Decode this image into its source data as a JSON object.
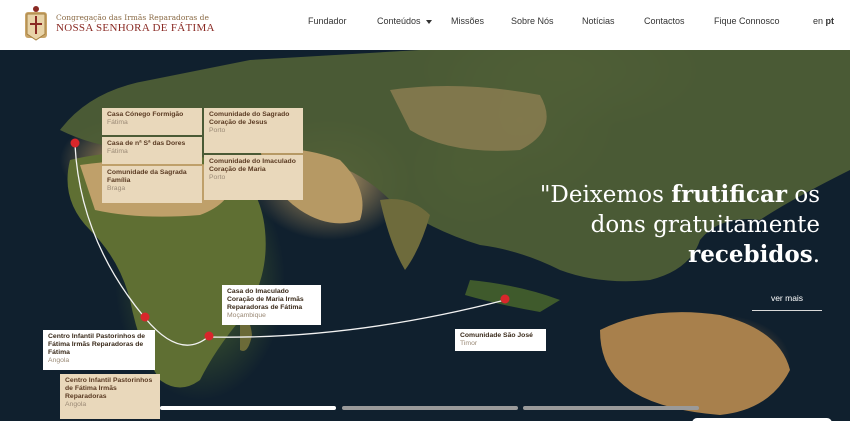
{
  "header": {
    "brand_small": "Congregação das Irmãs Reparadoras de",
    "brand_big": "NOSSA SENHORA DE FÁTIMA",
    "nav": [
      {
        "label": "Fundador"
      },
      {
        "label": "Conteúdos"
      },
      {
        "label": "Missões"
      },
      {
        "label": "Sobre Nós"
      },
      {
        "label": "Notícias"
      },
      {
        "label": "Contactos"
      },
      {
        "label": "Fique Connosco"
      }
    ],
    "lang_en": "en",
    "lang_pt": "pt"
  },
  "hero": {
    "locations": [
      {
        "title": "Casa Cónego Formigão",
        "place": "Fátima"
      },
      {
        "title": "Casa de nª Sª das Dores",
        "place": "Fátima"
      },
      {
        "title": "Comunidade da Sagrada Família",
        "place": "Braga"
      },
      {
        "title": "Comunidade do Sagrado Coração de Jesus",
        "place": "Porto"
      },
      {
        "title": "Comunidade do Imaculado Coração de Maria",
        "place": "Porto"
      },
      {
        "title": "Casa do Imaculado Coração de Maria Irmãs Reparadoras de Fátima",
        "place": "Moçambique"
      },
      {
        "title": "Centro Infantil Pastorinhos de Fátima Irmãs Reparadoras de Fátima",
        "place": "Angola"
      },
      {
        "title": "Centro Infantil Pastorinhos de Fátima Irmãs Reparadoras",
        "place": "Angola"
      },
      {
        "title": "Comunidade São José",
        "place": "Timor"
      }
    ],
    "quote": {
      "part1": "\"Deixemos ",
      "bold1": "frutificar",
      "part2": " os",
      "line2": "dons gratuitamente",
      "bold2": "recebidos",
      "end": "."
    },
    "see_more": "ver mais",
    "slides": {
      "count": 3,
      "active": 0
    }
  },
  "colors": {
    "brand_red": "#8a2a24",
    "card_beige": "#e9d8bb",
    "pin_red": "#d8262b",
    "ocean": "#10202e"
  }
}
